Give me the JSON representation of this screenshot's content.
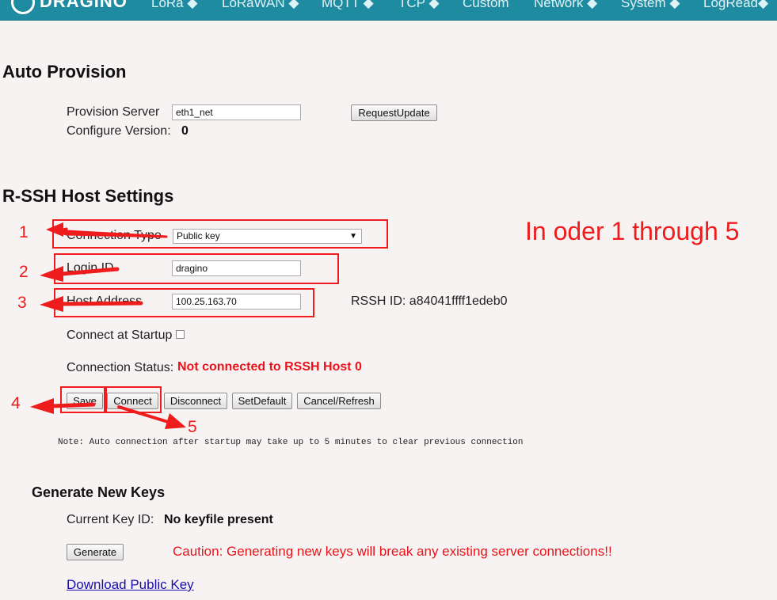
{
  "nav": {
    "logo": "DRAGINO",
    "items": [
      "LoRa",
      "LoRaWAN",
      "MQTT",
      "TCP",
      "Custom",
      "Network",
      "System",
      "LogRead"
    ],
    "dropdown_marker": "◆"
  },
  "auto_provision": {
    "title": "Auto Provision",
    "server_label": "Provision Server",
    "server_value": "eth1_net",
    "request_button": "RequestUpdate",
    "version_label": "Configure Version:",
    "version_value": "0"
  },
  "rssh": {
    "title": "R-SSH Host Settings",
    "connection_type_label": "Connection Type",
    "connection_type_value": "Public key",
    "login_label": "Login ID",
    "login_value": "dragino",
    "host_label": "Host Address",
    "host_value": "100.25.163.70",
    "rssh_id": "RSSH ID: a84041ffff1edeb0",
    "startup_label": "Connect at Startup",
    "status_label": "Connection Status:",
    "status_value": "Not connected to RSSH Host 0",
    "buttons": {
      "save": "Save",
      "connect": "Connect",
      "disconnect": "Disconnect",
      "setdefault": "SetDefault",
      "cancel": "Cancel/Refresh"
    },
    "note": "Note: Auto connection after startup may take up to 5 minutes to clear previous connection"
  },
  "keys": {
    "title": "Generate New Keys",
    "current_label": "Current Key ID:",
    "current_value": "No keyfile present",
    "generate_button": "Generate",
    "caution": "Caution: Generating new keys will break any existing server connections!!",
    "download_link": "Download Public Key"
  },
  "annotations": {
    "heading": "In oder 1 through 5",
    "numbers": [
      "1",
      "2",
      "3",
      "4",
      "5"
    ],
    "color": "#ee1c1c"
  }
}
